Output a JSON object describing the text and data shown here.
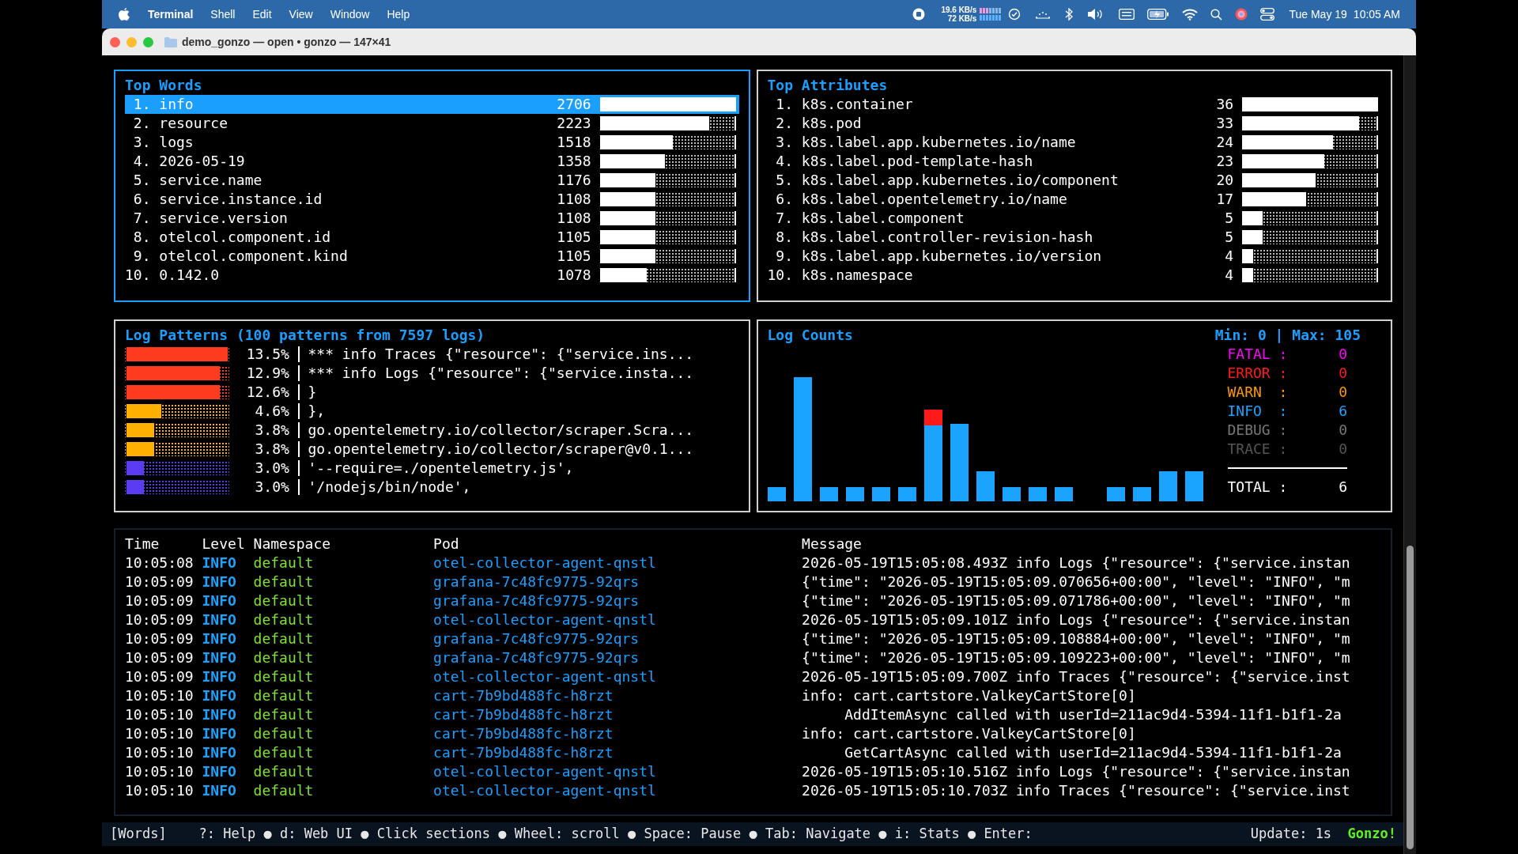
{
  "menu_bar": {
    "app": "Terminal",
    "menus": [
      "Shell",
      "Edit",
      "View",
      "Window",
      "Help"
    ],
    "net_up": "19.6 KB/s",
    "net_down": "72 KB/s",
    "date": "Tue May 19",
    "time": "10:05 AM"
  },
  "window": {
    "title": "demo_gonzo — open • gonzo — 147×41"
  },
  "top_words": {
    "title": "Top Words",
    "focused": true,
    "items": [
      {
        "rank": "1.",
        "word": "info",
        "count": "2706",
        "level": 1.0,
        "selected": true
      },
      {
        "rank": "2.",
        "word": "resource",
        "count": "2223",
        "level": 0.81,
        "selected": false
      },
      {
        "rank": "3.",
        "word": "logs",
        "count": "1518",
        "level": 0.54,
        "selected": false
      },
      {
        "rank": "4.",
        "word": "2026-05-19",
        "count": "1358",
        "level": 0.48,
        "selected": false
      },
      {
        "rank": "5.",
        "word": "service.name",
        "count": "1176",
        "level": 0.41,
        "selected": false
      },
      {
        "rank": "6.",
        "word": "service.instance.id",
        "count": "1108",
        "level": 0.41,
        "selected": false
      },
      {
        "rank": "7.",
        "word": "service.version",
        "count": "1108",
        "level": 0.41,
        "selected": false
      },
      {
        "rank": "8.",
        "word": "otelcol.component.id",
        "count": "1105",
        "level": 0.41,
        "selected": false
      },
      {
        "rank": "9.",
        "word": "otelcol.component.kind",
        "count": "1105",
        "level": 0.41,
        "selected": false
      },
      {
        "rank": "10.",
        "word": "0.142.0",
        "count": "1078",
        "level": 0.34,
        "selected": false
      }
    ]
  },
  "top_attributes": {
    "title": "Top Attributes",
    "focused": false,
    "items": [
      {
        "rank": "1.",
        "word": "k8s.container",
        "count": "36",
        "level": 1.0,
        "selected": false
      },
      {
        "rank": "2.",
        "word": "k8s.pod",
        "count": "33",
        "level": 0.87,
        "selected": false
      },
      {
        "rank": "3.",
        "word": "k8s.label.app.kubernetes.io/name",
        "count": "24",
        "level": 0.67,
        "selected": false
      },
      {
        "rank": "4.",
        "word": "k8s.label.pod-template-hash",
        "count": "23",
        "level": 0.61,
        "selected": false
      },
      {
        "rank": "5.",
        "word": "k8s.label.app.kubernetes.io/component",
        "count": "20",
        "level": 0.54,
        "selected": false
      },
      {
        "rank": "6.",
        "word": "k8s.label.opentelemetry.io/name",
        "count": "17",
        "level": 0.47,
        "selected": false
      },
      {
        "rank": "7.",
        "word": "k8s.label.component",
        "count": "5",
        "level": 0.14,
        "selected": false
      },
      {
        "rank": "8.",
        "word": "k8s.label.controller-revision-hash",
        "count": "5",
        "level": 0.14,
        "selected": false
      },
      {
        "rank": "9.",
        "word": "k8s.label.app.kubernetes.io/version",
        "count": "4",
        "level": 0.07,
        "selected": false
      },
      {
        "rank": "10.",
        "word": "k8s.namespace",
        "count": "4",
        "level": 0.07,
        "selected": false
      }
    ]
  },
  "log_patterns": {
    "title": "Log Patterns (100 patterns from 7597 logs)",
    "focused": false,
    "items": [
      {
        "percent": "13.5%",
        "pattern": "*** info Traces {\"resource\": {\"service.ins...",
        "level": 1.0,
        "color": "#ff3b1f"
      },
      {
        "percent": "12.9%",
        "pattern": "*** info Logs {\"resource\": {\"service.insta...",
        "level": 0.92,
        "color": "#ff3b1f"
      },
      {
        "percent": "12.6%",
        "pattern": "}",
        "level": 0.92,
        "color": "#ff3b1f"
      },
      {
        "percent": "4.6%",
        "pattern": "},",
        "level": 0.34,
        "color": "#ffb000"
      },
      {
        "percent": "3.8%",
        "pattern": "go.opentelemetry.io/collector/scraper.Scra...",
        "level": 0.27,
        "color": "#ffb000"
      },
      {
        "percent": "3.8%",
        "pattern": "go.opentelemetry.io/collector/scraper@v0.1...",
        "level": 0.27,
        "color": "#ffb000"
      },
      {
        "percent": "3.0%",
        "pattern": "'--require=./opentelemetry.js',",
        "level": 0.17,
        "color": "#5b3cf0"
      },
      {
        "percent": "3.0%",
        "pattern": "'/nodejs/bin/node',",
        "level": 0.17,
        "color": "#5b3cf0"
      }
    ]
  },
  "log_counts": {
    "title": "Log Counts",
    "range": "Min: 0 | Max: 105",
    "focused": false,
    "levels": [
      {
        "name": "FATAL",
        "separator": ":",
        "count": "0",
        "color": "#ff00ff"
      },
      {
        "name": "ERROR",
        "separator": ":",
        "count": "0",
        "color": "#ff1a1a"
      },
      {
        "name": "WARN",
        "separator": ":",
        "count": "0",
        "color": "#ff9900"
      },
      {
        "name": "INFO",
        "separator": ":",
        "count": "6",
        "color": "#1aa3ff"
      },
      {
        "name": "DEBUG",
        "separator": ":",
        "count": "0",
        "color": "#777777"
      },
      {
        "name": "TRACE",
        "separator": ":",
        "count": "0",
        "color": "#555555"
      }
    ],
    "total": {
      "name": "TOTAL",
      "separator": ":",
      "count": "6"
    }
  },
  "log_table": {
    "columns": [
      "Time",
      "Level",
      "Namespace",
      "Pod",
      "Message"
    ],
    "rows": [
      {
        "time": "10:05:08",
        "level": "INFO",
        "namespace": "default",
        "pod": "otel-collector-agent-qnstl",
        "message": "2026-05-19T15:05:08.493Z info Logs {\"resource\": {\"service.instan",
        "continuation": false
      },
      {
        "time": "10:05:09",
        "level": "INFO",
        "namespace": "default",
        "pod": "grafana-7c48fc9775-92qrs",
        "message": "{\"time\": \"2026-05-19T15:05:09.070656+00:00\", \"level\": \"INFO\", \"m",
        "continuation": false
      },
      {
        "time": "10:05:09",
        "level": "INFO",
        "namespace": "default",
        "pod": "grafana-7c48fc9775-92qrs",
        "message": "{\"time\": \"2026-05-19T15:05:09.071786+00:00\", \"level\": \"INFO\", \"m",
        "continuation": false
      },
      {
        "time": "10:05:09",
        "level": "INFO",
        "namespace": "default",
        "pod": "otel-collector-agent-qnstl",
        "message": "2026-05-19T15:05:09.101Z info Logs {\"resource\": {\"service.instan",
        "continuation": false
      },
      {
        "time": "10:05:09",
        "level": "INFO",
        "namespace": "default",
        "pod": "grafana-7c48fc9775-92qrs",
        "message": "{\"time\": \"2026-05-19T15:05:09.108884+00:00\", \"level\": \"INFO\", \"m",
        "continuation": false
      },
      {
        "time": "10:05:09",
        "level": "INFO",
        "namespace": "default",
        "pod": "grafana-7c48fc9775-92qrs",
        "message": "{\"time\": \"2026-05-19T15:05:09.109223+00:00\", \"level\": \"INFO\", \"m",
        "continuation": false
      },
      {
        "time": "10:05:09",
        "level": "INFO",
        "namespace": "default",
        "pod": "otel-collector-agent-qnstl",
        "message": "2026-05-19T15:05:09.700Z info Traces {\"resource\": {\"service.inst",
        "continuation": false
      },
      {
        "time": "10:05:10",
        "level": "INFO",
        "namespace": "default",
        "pod": "cart-7b9bd488fc-h8rzt",
        "message": "info: cart.cartstore.ValkeyCartStore[0]",
        "continuation": false
      },
      {
        "time": "10:05:10",
        "level": "INFO",
        "namespace": "default",
        "pod": "cart-7b9bd488fc-h8rzt",
        "message": "AddItemAsync called with userId=211ac9d4-5394-11f1-b1f1-2a",
        "continuation": true
      },
      {
        "time": "10:05:10",
        "level": "INFO",
        "namespace": "default",
        "pod": "cart-7b9bd488fc-h8rzt",
        "message": "info: cart.cartstore.ValkeyCartStore[0]",
        "continuation": false
      },
      {
        "time": "10:05:10",
        "level": "INFO",
        "namespace": "default",
        "pod": "cart-7b9bd488fc-h8rzt",
        "message": "GetCartAsync called with userId=211ac9d4-5394-11f1-b1f1-2a",
        "continuation": true
      },
      {
        "time": "10:05:10",
        "level": "INFO",
        "namespace": "default",
        "pod": "otel-collector-agent-qnstl",
        "message": "2026-05-19T15:05:10.516Z info Logs {\"resource\": {\"service.instan",
        "continuation": false
      },
      {
        "time": "10:05:10",
        "level": "INFO",
        "namespace": "default",
        "pod": "otel-collector-agent-qnstl",
        "message": "2026-05-19T15:05:10.703Z info Traces {\"resource\": {\"service.inst",
        "continuation": false
      }
    ]
  },
  "status_bar": {
    "mode": "[Words]",
    "hints": "?: Help ● d: Web UI ● Click sections ● Wheel: scroll ● Space: Pause ● Tab: Navigate ● i: Stats ● Enter:",
    "update": "Update: 1s",
    "brand": "Gonzo!"
  }
}
